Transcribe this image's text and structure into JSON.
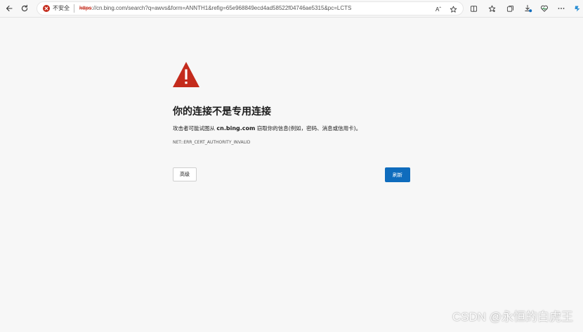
{
  "browser": {
    "security_label": "不安全",
    "url_scheme": "https",
    "url_rest": "://cn.bing.com/search?q=awvs&form=ANNTH1&refig=65e968849ecd4ad58522f04746ae5315&pc=LCTS",
    "read_aloud_label": "Aˆ"
  },
  "page": {
    "title": "你的连接不是专用连接",
    "description_prefix": "攻击者可能试图从 ",
    "description_host": "cn.bing.com",
    "description_suffix": " 窃取你的信息(例如，密码、消息或信用卡)。",
    "error_code": "NET::ERR_CERT_AUTHORITY_INVALID",
    "advanced_button": "高级",
    "refresh_button": "刷新"
  },
  "watermark": {
    "text": "CSDN @永恒的白虎王"
  },
  "colors": {
    "warning_red": "#c42b1c",
    "primary_button": "#0f6cbd",
    "background": "#f7f7f7"
  }
}
